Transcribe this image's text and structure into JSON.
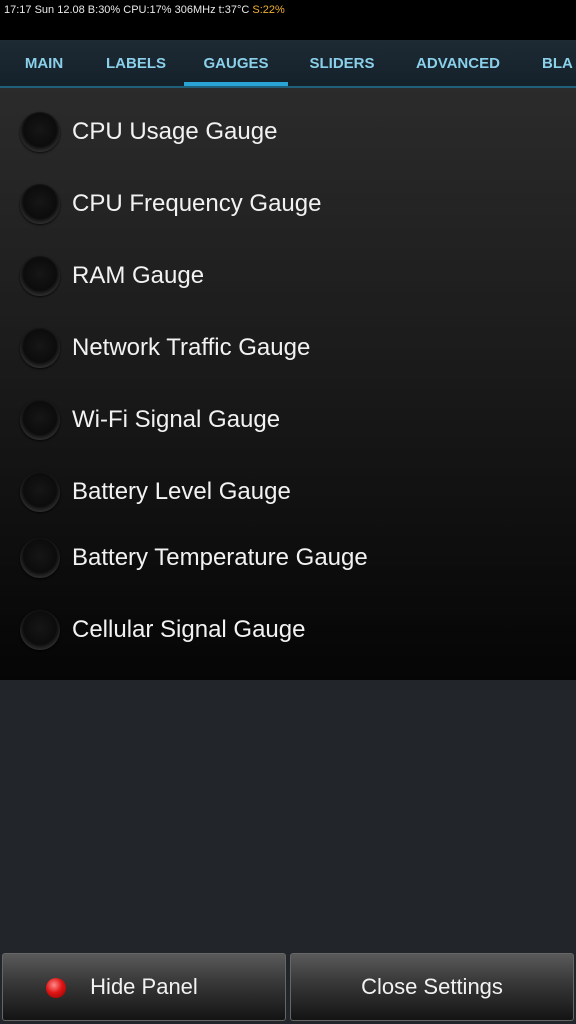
{
  "status_bar": {
    "text": "17:17 Sun 12.08 B:30% CPU:17% 306MHz t:37°C ",
    "accent_text": "S:22%",
    "accent_color": "#f0b030"
  },
  "tabs": [
    {
      "label": "MAIN"
    },
    {
      "label": "LABELS"
    },
    {
      "label": "GAUGES",
      "active": true
    },
    {
      "label": "SLIDERS"
    },
    {
      "label": "ADVANCED"
    },
    {
      "label": "BLA"
    }
  ],
  "accent_color": "#2aa4d4",
  "gauges": [
    {
      "label": "CPU Usage Gauge",
      "selected": false
    },
    {
      "label": "CPU Frequency Gauge",
      "selected": false
    },
    {
      "label": "RAM Gauge",
      "selected": false
    },
    {
      "label": "Network Traffic Gauge",
      "selected": false
    },
    {
      "label": "Wi-Fi Signal Gauge",
      "selected": false
    },
    {
      "label": "Battery Level Gauge",
      "selected": false
    },
    {
      "label": "Battery Temperature Gauge",
      "selected": false
    },
    {
      "label": "Cellular Signal Gauge",
      "selected": false
    }
  ],
  "buttons": {
    "hide_panel": {
      "label": "Hide Panel",
      "indicator_icon": "red-led-icon"
    },
    "close_settings": {
      "label": "Close Settings"
    }
  }
}
